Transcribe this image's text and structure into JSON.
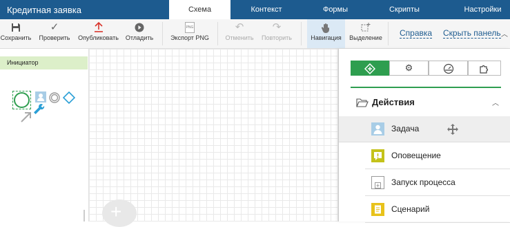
{
  "app": {
    "title": "Кредитная заявка"
  },
  "tabs": [
    {
      "label": "Схема",
      "active": true
    },
    {
      "label": "Контекст"
    },
    {
      "label": "Формы"
    },
    {
      "label": "Скрипты"
    },
    {
      "label": "Настройки"
    }
  ],
  "toolbar": {
    "save": "Сохранить",
    "check": "Проверить",
    "publish": "Опубликовать",
    "debug": "Отладить",
    "export": "Экспорт PNG",
    "export_badge": "PNG",
    "undo": "Отменить",
    "redo": "Повторить",
    "navigation": "Навигация",
    "selection": "Выделение",
    "help": "Справка",
    "hide_panel": "Скрыть панель"
  },
  "lane": {
    "label": "Инициатор"
  },
  "right_panel": {
    "section_title": "Действия",
    "items": [
      {
        "label": "Задача",
        "icon": "user-task-icon",
        "color": "#a8cde6"
      },
      {
        "label": "Оповещение",
        "icon": "notification-icon",
        "color": "#c4c21a"
      },
      {
        "label": "Запуск процесса",
        "icon": "subprocess-icon",
        "color": "#ffffff"
      },
      {
        "label": "Сценарий",
        "icon": "script-icon",
        "color": "#e8c21a"
      }
    ]
  },
  "colors": {
    "header": "#1d5b8f",
    "accent_green": "#2e9e4f",
    "lane": "#dcefc9"
  }
}
